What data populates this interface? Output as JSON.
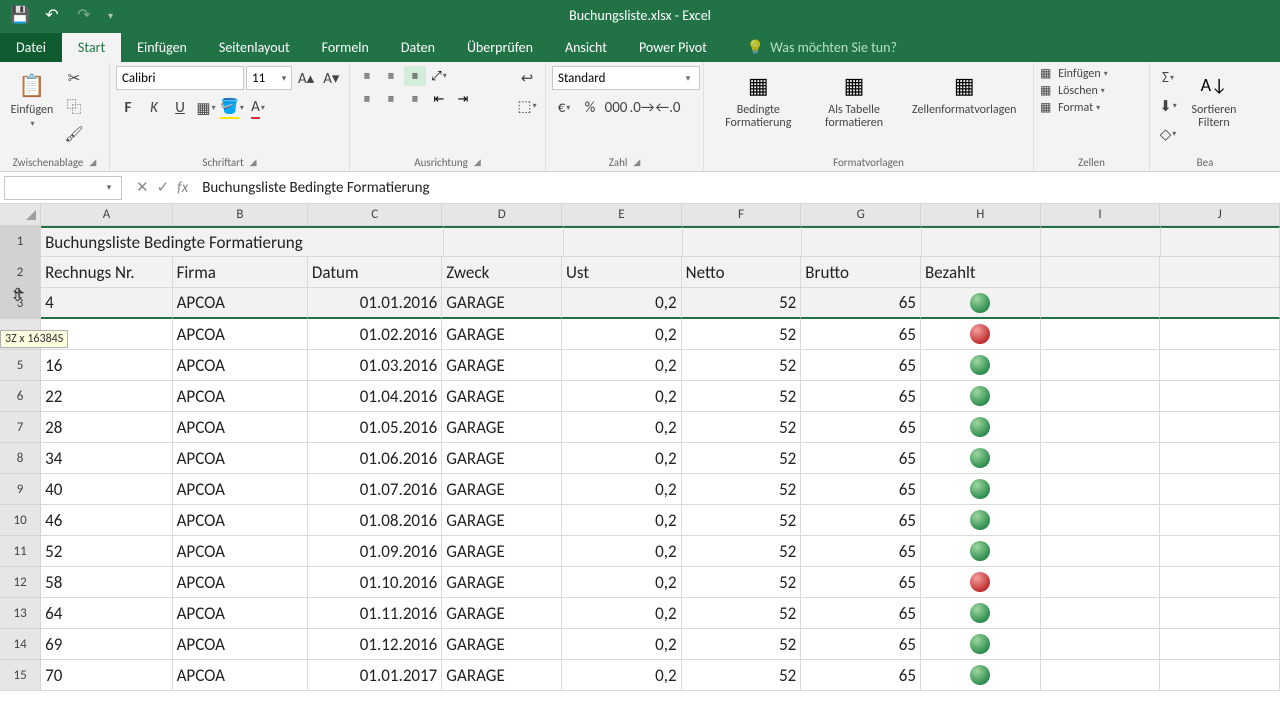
{
  "window": {
    "title": "Buchungsliste.xlsx - Excel"
  },
  "tabs": {
    "file": "Datei",
    "start": "Start",
    "einfugen": "Einfügen",
    "seitenlayout": "Seitenlayout",
    "formeln": "Formeln",
    "daten": "Daten",
    "uberprufen": "Überprüfen",
    "ansicht": "Ansicht",
    "powerpivot": "Power Pivot"
  },
  "tellme": {
    "placeholder": "Was möchten Sie tun?"
  },
  "ribbon": {
    "clipboard": {
      "paste": "Einfügen",
      "group": "Zwischenablage"
    },
    "font": {
      "name": "Calibri",
      "size": "11",
      "group": "Schriftart",
      "bold": "F",
      "italic": "K",
      "underline": "U"
    },
    "alignment": {
      "group": "Ausrichtung"
    },
    "number": {
      "format": "Standard",
      "group": "Zahl"
    },
    "styles": {
      "cond": "Bedingte Formatierung",
      "table": "Als Tabelle formatieren",
      "cell": "Zellenformatvorlagen",
      "group": "Formatvorlagen"
    },
    "cells": {
      "insert": "Einfügen",
      "delete": "Löschen",
      "format": "Format",
      "group": "Zellen"
    },
    "editing": {
      "sort": "Sortieren",
      "filter": "Filtern",
      "group": "Bea"
    }
  },
  "formula_bar": {
    "name_box": "",
    "value": "Buchungsliste Bedingte Formatierung"
  },
  "selection_tip": "3Z x 16384S",
  "columns": [
    "A",
    "B",
    "C",
    "D",
    "E",
    "F",
    "G",
    "H",
    "I",
    "J"
  ],
  "sheet": {
    "title": "Buchungsliste Bedingte Formatierung",
    "headers": {
      "a": "Rechnugs Nr.",
      "b": "Firma",
      "c": "Datum",
      "d": "Zweck",
      "e": "Ust",
      "f": "Netto",
      "g": "Brutto",
      "h": "Bezahlt"
    },
    "rows": [
      {
        "n": "3",
        "a": "4",
        "b": "APCOA",
        "c": "01.01.2016",
        "d": "GARAGE",
        "e": "0,2",
        "f": "52",
        "g": "65",
        "dot": "green"
      },
      {
        "n": "",
        "a": "",
        "b": "APCOA",
        "c": "01.02.2016",
        "d": "GARAGE",
        "e": "0,2",
        "f": "52",
        "g": "65",
        "dot": "red"
      },
      {
        "n": "5",
        "a": "16",
        "b": "APCOA",
        "c": "01.03.2016",
        "d": "GARAGE",
        "e": "0,2",
        "f": "52",
        "g": "65",
        "dot": "green"
      },
      {
        "n": "6",
        "a": "22",
        "b": "APCOA",
        "c": "01.04.2016",
        "d": "GARAGE",
        "e": "0,2",
        "f": "52",
        "g": "65",
        "dot": "green"
      },
      {
        "n": "7",
        "a": "28",
        "b": "APCOA",
        "c": "01.05.2016",
        "d": "GARAGE",
        "e": "0,2",
        "f": "52",
        "g": "65",
        "dot": "green"
      },
      {
        "n": "8",
        "a": "34",
        "b": "APCOA",
        "c": "01.06.2016",
        "d": "GARAGE",
        "e": "0,2",
        "f": "52",
        "g": "65",
        "dot": "green"
      },
      {
        "n": "9",
        "a": "40",
        "b": "APCOA",
        "c": "01.07.2016",
        "d": "GARAGE",
        "e": "0,2",
        "f": "52",
        "g": "65",
        "dot": "green"
      },
      {
        "n": "10",
        "a": "46",
        "b": "APCOA",
        "c": "01.08.2016",
        "d": "GARAGE",
        "e": "0,2",
        "f": "52",
        "g": "65",
        "dot": "green"
      },
      {
        "n": "11",
        "a": "52",
        "b": "APCOA",
        "c": "01.09.2016",
        "d": "GARAGE",
        "e": "0,2",
        "f": "52",
        "g": "65",
        "dot": "green"
      },
      {
        "n": "12",
        "a": "58",
        "b": "APCOA",
        "c": "01.10.2016",
        "d": "GARAGE",
        "e": "0,2",
        "f": "52",
        "g": "65",
        "dot": "red"
      },
      {
        "n": "13",
        "a": "64",
        "b": "APCOA",
        "c": "01.11.2016",
        "d": "GARAGE",
        "e": "0,2",
        "f": "52",
        "g": "65",
        "dot": "green"
      },
      {
        "n": "14",
        "a": "69",
        "b": "APCOA",
        "c": "01.12.2016",
        "d": "GARAGE",
        "e": "0,2",
        "f": "52",
        "g": "65",
        "dot": "green"
      },
      {
        "n": "15",
        "a": "70",
        "b": "APCOA",
        "c": "01.01.2017",
        "d": "GARAGE",
        "e": "0,2",
        "f": "52",
        "g": "65",
        "dot": "green"
      }
    ]
  }
}
